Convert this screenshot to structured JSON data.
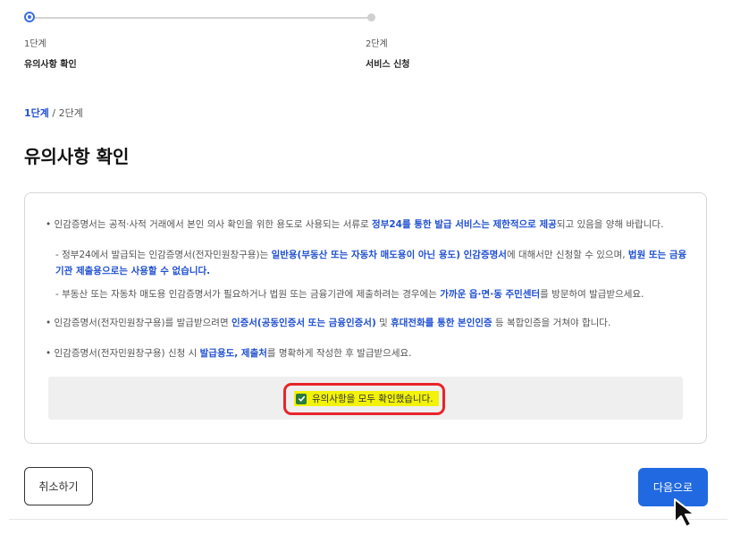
{
  "stepper": {
    "steps": [
      {
        "num": "1단계",
        "name": "유의사항 확인"
      },
      {
        "num": "2단계",
        "name": "서비스 신청"
      }
    ]
  },
  "breadcrumb": {
    "current": "1단계",
    "sep": " / ",
    "next": "2단계"
  },
  "page_title": "유의사항 확인",
  "notes": {
    "n1": {
      "pre": "인감증명서는 공적·사적 거래에서 본인 의사 확인을 위한 용도로 사용되는 서류로 ",
      "em": "정부24를 통한 발급 서비스는 제한적으로 제공",
      "post": "되고 있음을 양해 바랍니다."
    },
    "s1": {
      "pre": "정부24에서 발급되는 인감증명서(전자민원창구용)는 ",
      "em1": "일반용(부동산 또는 자동차 매도용이 아닌 용도) 인감증명서",
      "mid": "에 대해서만 신청할 수 있으며, ",
      "em2": "법원 또는 금융기관 제출용으로는 사용할 수 없습니다."
    },
    "s2": {
      "pre": "부동산 또는 자동차 매도용 인감증명서가 필요하거나 법원 또는 금융기관에 제출하려는 경우에는 ",
      "em": "가까운 읍·면·동 주민센터",
      "post": "를 방문하여 발급받으세요."
    },
    "n2": {
      "pre": "인감증명서(전자민원창구용)를 발급받으려면 ",
      "em1": "인증서(공동인증서 또는 금융인증서)",
      "mid": " 및 ",
      "em2": "휴대전화를 통한 본인인증",
      "post": " 등 복합인증을 거쳐야 합니다."
    },
    "n3": {
      "pre": "인감증명서(전자민원창구용) 신청 시 ",
      "em": "발급용도, 제출처",
      "post": "를 명확하게 작성한 후 발급받으세요."
    }
  },
  "confirm": {
    "label": "유의사항을 모두 확인했습니다.",
    "checked": true
  },
  "buttons": {
    "cancel": "취소하기",
    "next": "다음으로"
  },
  "colors": {
    "accent": "#2169e0",
    "highlight": "#f2f20a",
    "outline": "#e8242a"
  }
}
